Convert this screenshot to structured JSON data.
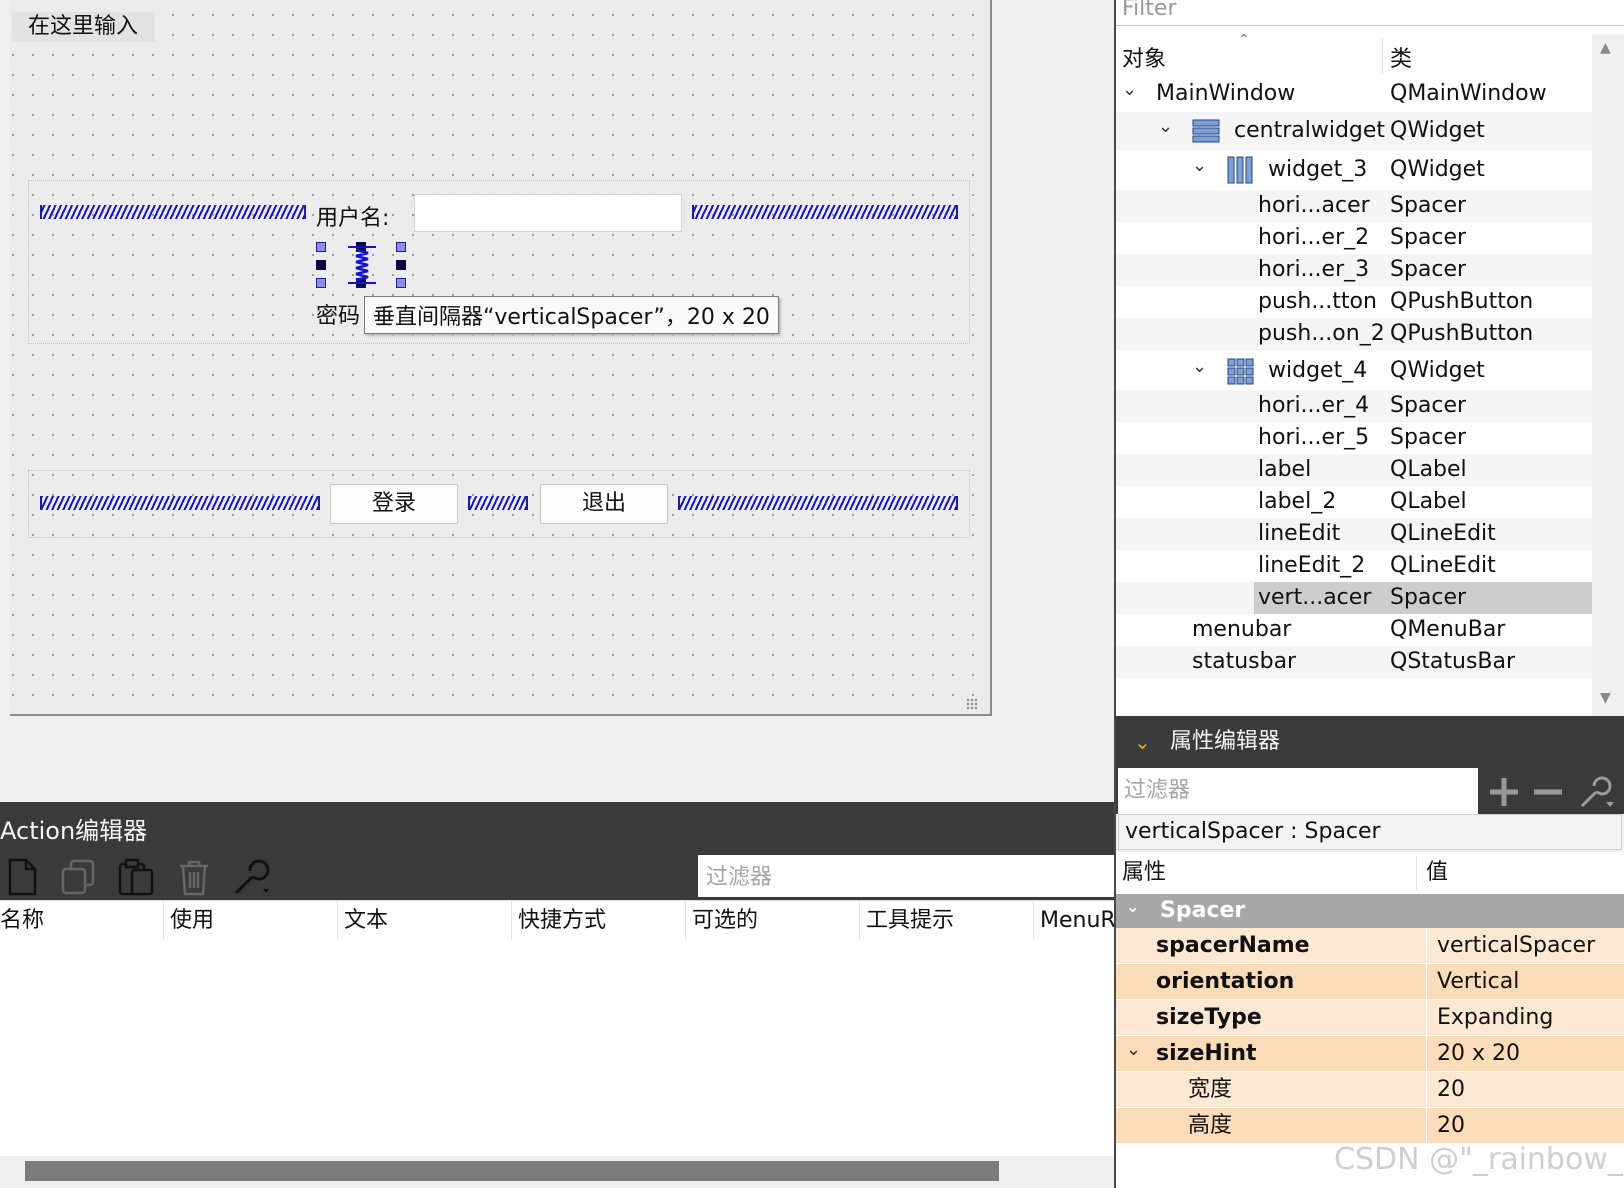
{
  "designer": {
    "menu_placeholder": "在这里输入",
    "username_label": "用户名:",
    "password_label": "密码",
    "tooltip": "垂直间隔器“verticalSpacer”，20 x 20",
    "login_button": "登录",
    "exit_button": "退出"
  },
  "action_editor": {
    "title": "Action编辑器",
    "filter_placeholder": "过滤器",
    "toolbar": [
      "new-icon",
      "copy-icon",
      "paste-icon",
      "delete-icon",
      "wrench-icon"
    ],
    "columns": [
      "名称",
      "使用",
      "文本",
      "快捷方式",
      "可选的",
      "工具提示",
      "MenuR"
    ]
  },
  "object_inspector": {
    "filter_placeholder": "Filter",
    "columns": [
      "对象",
      "类"
    ],
    "rows": [
      {
        "name": "MainWindow",
        "class": "QMainWindow",
        "expanded": true
      },
      {
        "name": "centralwidget",
        "class": "QWidget",
        "icon": "vertical-layout-icon",
        "expanded": true
      },
      {
        "name": "widget_3",
        "class": "QWidget",
        "icon": "horizontal-layout-icon",
        "expanded": true
      },
      {
        "name": "hori...acer",
        "class": "Spacer"
      },
      {
        "name": "hori...er_2",
        "class": "Spacer"
      },
      {
        "name": "hori...er_3",
        "class": "Spacer"
      },
      {
        "name": "push...tton",
        "class": "QPushButton"
      },
      {
        "name": "push...on_2",
        "class": "QPushButton"
      },
      {
        "name": "widget_4",
        "class": "QWidget",
        "icon": "grid-layout-icon",
        "expanded": true
      },
      {
        "name": "hori...er_4",
        "class": "Spacer"
      },
      {
        "name": "hori...er_5",
        "class": "Spacer"
      },
      {
        "name": "label",
        "class": "QLabel"
      },
      {
        "name": "label_2",
        "class": "QLabel"
      },
      {
        "name": "lineEdit",
        "class": "QLineEdit"
      },
      {
        "name": "lineEdit_2",
        "class": "QLineEdit"
      },
      {
        "name": "vert...acer",
        "class": "Spacer",
        "selected": true
      },
      {
        "name": "menubar",
        "class": "QMenuBar"
      },
      {
        "name": "statusbar",
        "class": "QStatusBar"
      }
    ]
  },
  "property_editor": {
    "title": "属性编辑器",
    "filter_placeholder": "过滤器",
    "object_label": "verticalSpacer : Spacer",
    "columns": [
      "属性",
      "值"
    ],
    "group": "Spacer",
    "properties": [
      {
        "name": "spacerName",
        "value": "verticalSpacer"
      },
      {
        "name": "orientation",
        "value": "Vertical"
      },
      {
        "name": "sizeType",
        "value": "Expanding"
      },
      {
        "name": "sizeHint",
        "value": "20 x 20"
      },
      {
        "name": "宽度",
        "value": "20"
      },
      {
        "name": "高度",
        "value": "20"
      }
    ]
  },
  "watermark": "CSDN @\"_rainbow_\"",
  "colors": {
    "accent_dark": "#3a3a3a",
    "spacer_blue": "#1414d0",
    "property_row": "#fde9d3",
    "property_row_alt": "#fbdcb8",
    "selection": "#cdcdcd"
  }
}
